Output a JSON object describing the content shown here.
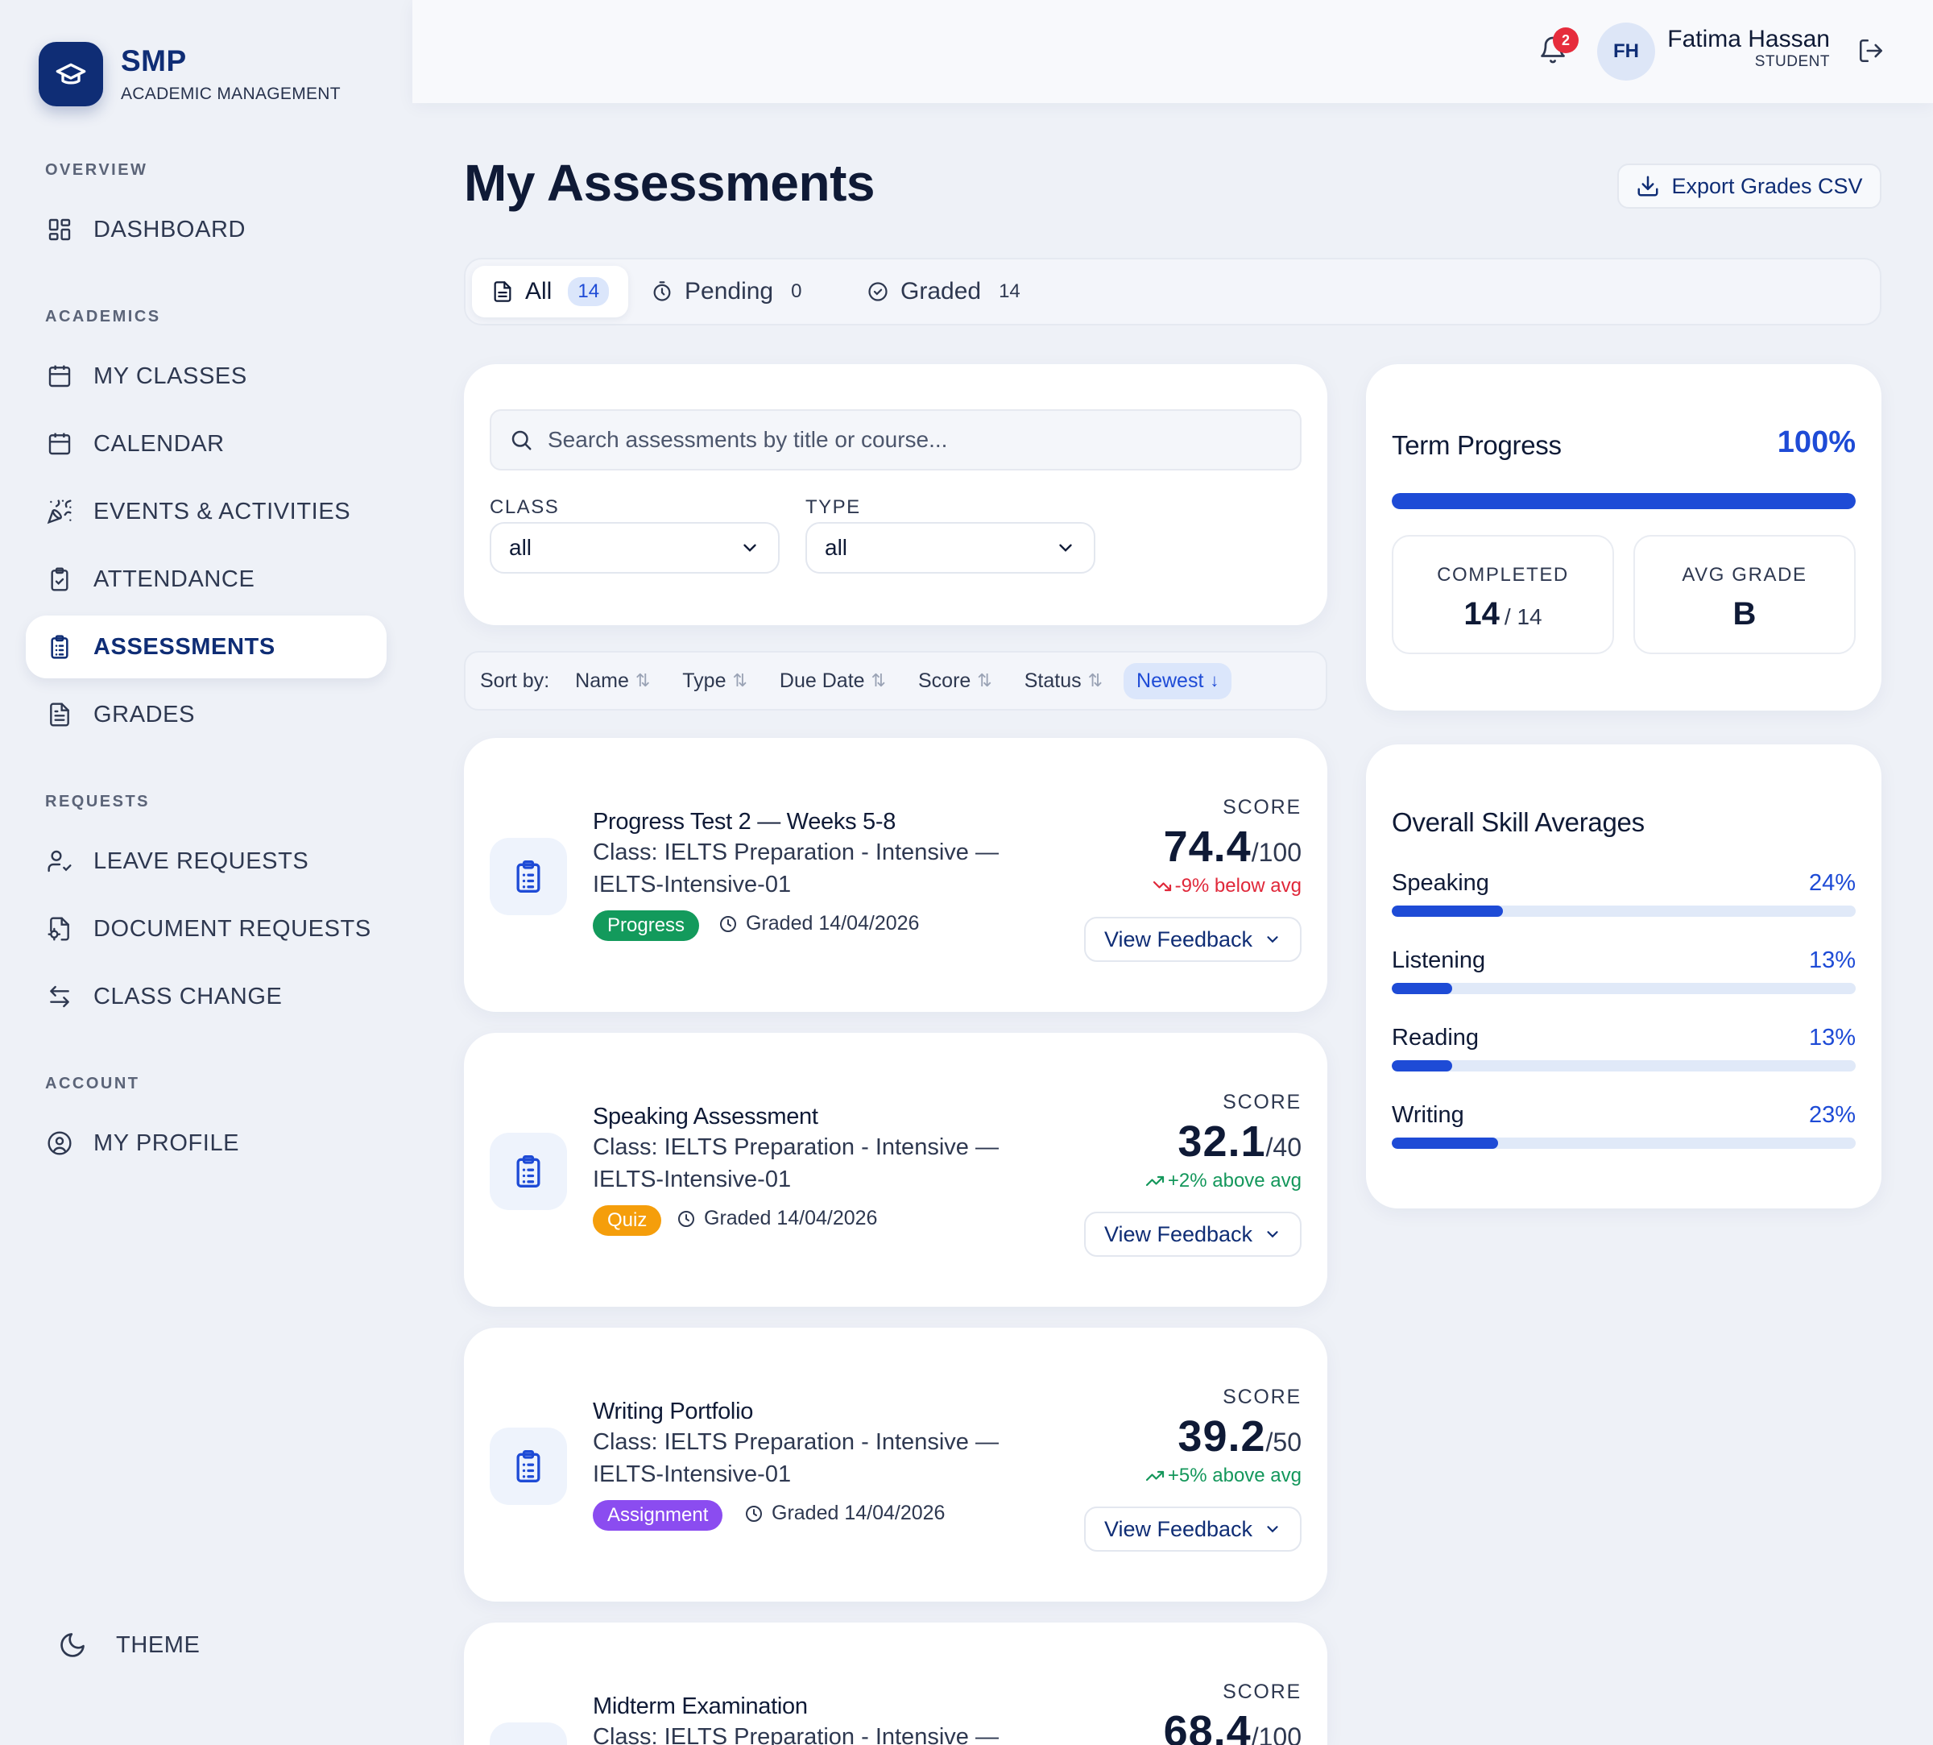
{
  "brand": {
    "name": "SMP",
    "subtitle": "ACADEMIC MANAGEMENT"
  },
  "sidebar": {
    "sections": [
      {
        "label": "OVERVIEW"
      },
      {
        "label": "ACADEMICS"
      },
      {
        "label": "REQUESTS"
      },
      {
        "label": "ACCOUNT"
      }
    ],
    "items": [
      {
        "label": "DASHBOARD",
        "icon": "dashboard-icon"
      },
      {
        "label": "MY CLASSES",
        "icon": "calendar-grid-icon"
      },
      {
        "label": "CALENDAR",
        "icon": "calendar-icon"
      },
      {
        "label": "EVENTS & ACTIVITIES",
        "icon": "party-popper-icon"
      },
      {
        "label": "ATTENDANCE",
        "icon": "clipboard-check-icon"
      },
      {
        "label": "ASSESSMENTS",
        "icon": "clipboard-list-icon",
        "active": true
      },
      {
        "label": "GRADES",
        "icon": "file-text-icon"
      },
      {
        "label": "LEAVE REQUESTS",
        "icon": "user-check-icon"
      },
      {
        "label": "DOCUMENT REQUESTS",
        "icon": "file-cog-icon"
      },
      {
        "label": "CLASS CHANGE",
        "icon": "arrows-swap-icon"
      },
      {
        "label": "MY PROFILE",
        "icon": "user-circle-icon"
      }
    ],
    "theme_label": "THEME"
  },
  "header": {
    "notification_count": "2",
    "avatar_initials": "FH",
    "user_name": "Fatima Hassan",
    "user_role": "STUDENT"
  },
  "page": {
    "title": "My Assessments",
    "export_label": "Export Grades CSV"
  },
  "tabs": [
    {
      "label": "All",
      "count": "14",
      "active": true
    },
    {
      "label": "Pending",
      "count": "0"
    },
    {
      "label": "Graded",
      "count": "14"
    }
  ],
  "filters": {
    "search_placeholder": "Search assessments by title or course...",
    "class_label": "CLASS",
    "class_value": "all",
    "type_label": "TYPE",
    "type_value": "all"
  },
  "sort": {
    "label": "Sort by:",
    "options": [
      "Name",
      "Type",
      "Due Date",
      "Score",
      "Status",
      "Newest"
    ],
    "active": "Newest"
  },
  "assessments": [
    {
      "title": "Progress Test 2 — Weeks 5-8",
      "class": "Class: IELTS Preparation - Intensive — IELTS-Intensive-01",
      "tag": "Progress",
      "tag_color": "#139a5c",
      "graded": "Graded 14/04/2026",
      "score_label": "SCORE",
      "score": "74.4",
      "max": "/100",
      "trend": "-9% below avg",
      "trend_dir": "down",
      "feedback_label": "View Feedback"
    },
    {
      "title": "Speaking Assessment",
      "class": "Class: IELTS Preparation - Intensive — IELTS-Intensive-01",
      "tag": "Quiz",
      "tag_color": "#f59e0b",
      "graded": "Graded 14/04/2026",
      "score_label": "SCORE",
      "score": "32.1",
      "max": "/40",
      "trend": "+2% above avg",
      "trend_dir": "up",
      "feedback_label": "View Feedback"
    },
    {
      "title": "Writing Portfolio",
      "class": "Class: IELTS Preparation - Intensive — IELTS-Intensive-01",
      "tag": "Assignment",
      "tag_color": "#8b4cf0",
      "graded": "Graded 14/04/2026",
      "score_label": "SCORE",
      "score": "39.2",
      "max": "/50",
      "trend": "+5% above avg",
      "trend_dir": "up",
      "feedback_label": "View Feedback"
    },
    {
      "title": "Midterm Examination",
      "class": "Class: IELTS Preparation - Intensive —",
      "score_label": "SCORE",
      "score": "68.4",
      "max": "/100"
    }
  ],
  "term_progress": {
    "title": "Term Progress",
    "percent_text": "100%",
    "percent": 1.0,
    "completed_label": "COMPLETED",
    "completed": "14",
    "completed_total": "/ 14",
    "avg_label": "AVG GRADE",
    "avg_grade": "B"
  },
  "skills": {
    "title": "Overall Skill Averages",
    "items": [
      {
        "name": "Speaking",
        "percent_text": "24%",
        "percent": 0.24
      },
      {
        "name": "Listening",
        "percent_text": "13%",
        "percent": 0.13
      },
      {
        "name": "Reading",
        "percent_text": "13%",
        "percent": 0.13
      },
      {
        "name": "Writing",
        "percent_text": "23%",
        "percent": 0.23
      }
    ]
  },
  "colors": {
    "brand": "#0f2d75",
    "accent": "#1e4bd6",
    "danger": "#e0283a",
    "success": "#14975b"
  }
}
